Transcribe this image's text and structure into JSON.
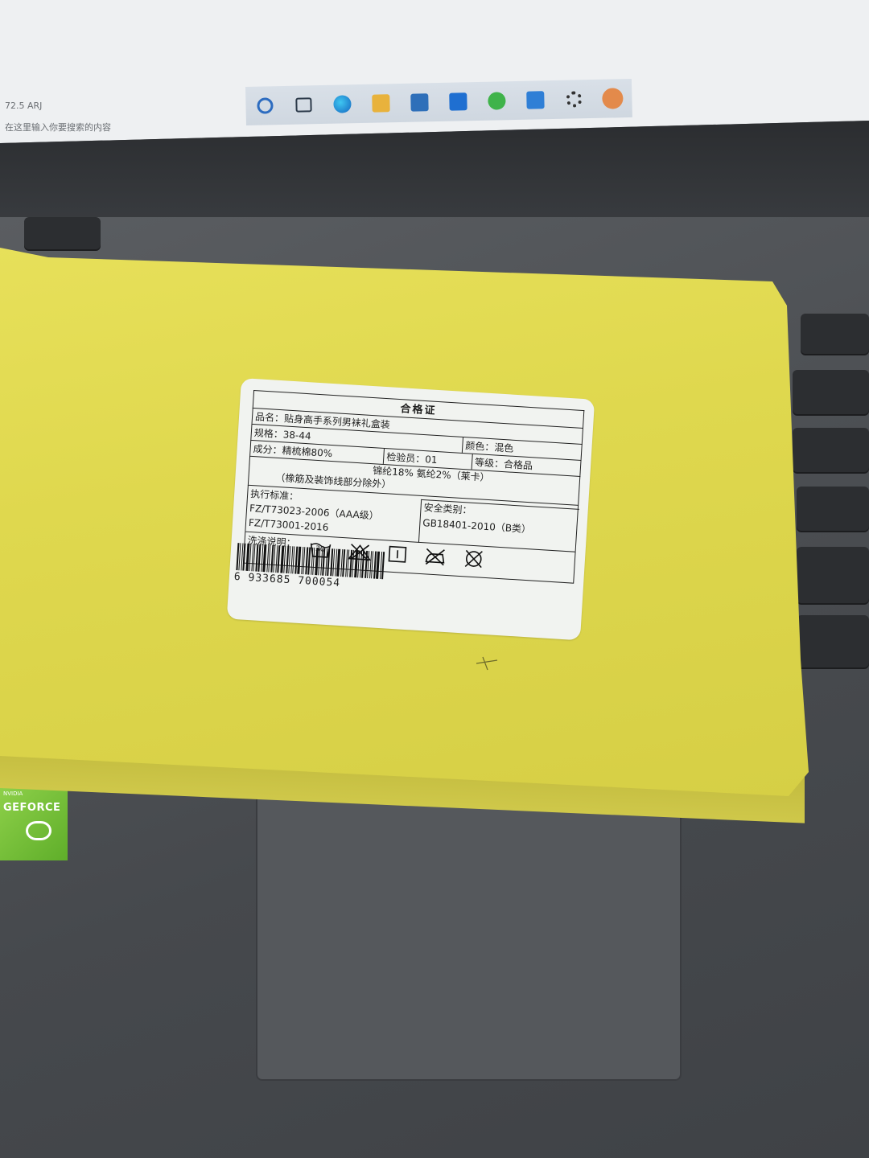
{
  "screen": {
    "text_lines": [
      "72.5 ARJ",
      "在这里输入你要搜索的内容"
    ],
    "taskbar_icons": [
      "cortana-icon",
      "task-view-icon",
      "edge-icon",
      "explorer-icon",
      "store-icon",
      "mail-icon",
      "wechat-icon",
      "app-icon",
      "settings-icon",
      "avatar-icon"
    ]
  },
  "sticker": {
    "top_text": "NVIDIA",
    "brand": "GEFORCE"
  },
  "certificate": {
    "title": "合格证",
    "product_name": "品名：贴身高手系列男袜礼盒装",
    "size": "规格：38-44",
    "color": "颜色：混色",
    "composition": "成分：精梳棉80%",
    "inspector": "检验员：01",
    "grade": "等级：合格品",
    "composition_2": "锦纶18%   氨纶2%（莱卡）",
    "composition_note": "（橡筋及装饰线部分除外）",
    "standard_label": "执行标准：",
    "standard_1": "FZ/T73023-2006（AAA级）",
    "standard_2": "FZ/T73001-2016",
    "safety_label": "安全类别：",
    "safety_value": "GB18401-2010（B类）",
    "wash_label": "洗涤说明：",
    "wash_temp": "30",
    "barcode_number": "6 933685 700054"
  }
}
